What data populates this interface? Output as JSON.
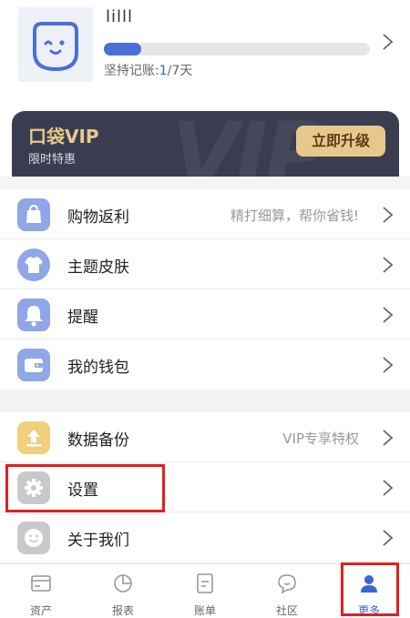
{
  "profile": {
    "username": "lilll",
    "progress": 0.14,
    "streak_prefix": "坚持记账:",
    "streak_current": "1",
    "streak_suffix": "/7天"
  },
  "vip": {
    "title": "口袋VIP",
    "subtitle": "限时特惠",
    "upgrade_label": "立即升级",
    "watermark": "VIP"
  },
  "menu_group_1": [
    {
      "label": "购物返利",
      "extra": "精打细算，帮你省钱!",
      "icon": "shopping-bag-icon",
      "color": "#8fa6e8"
    },
    {
      "label": "主题皮肤",
      "extra": "",
      "icon": "tshirt-icon",
      "color": "#8fa6e8"
    },
    {
      "label": "提醒",
      "extra": "",
      "icon": "bell-icon",
      "color": "#8fa6e8"
    },
    {
      "label": "我的钱包",
      "extra": "",
      "icon": "wallet-icon",
      "color": "#8fa6e8"
    }
  ],
  "menu_group_2": [
    {
      "label": "数据备份",
      "extra": "VIP专享特权",
      "icon": "upload-icon",
      "color": "#f2cf7c"
    },
    {
      "label": "设置",
      "extra": "",
      "icon": "gear-icon",
      "color": "#c9c9cc"
    },
    {
      "label": "关于我们",
      "extra": "",
      "icon": "smiley-icon",
      "color": "#c9c9cc"
    }
  ],
  "tabbar": [
    {
      "label": "资产",
      "icon": "card-icon",
      "active": false
    },
    {
      "label": "报表",
      "icon": "pie-chart-icon",
      "active": false
    },
    {
      "label": "账单",
      "icon": "bill-icon",
      "active": false
    },
    {
      "label": "社区",
      "icon": "chat-bubble-icon",
      "active": false
    },
    {
      "label": "更多",
      "icon": "person-icon",
      "active": true
    }
  ],
  "colors": {
    "accent": "#3b63d3",
    "vip_bg": "#3a3d50",
    "vip_gold": "#e8c78d",
    "highlight": "#e02020"
  }
}
